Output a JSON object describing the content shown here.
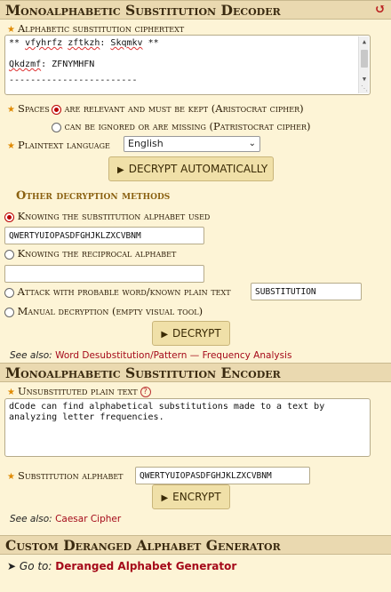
{
  "decoder": {
    "title": "Monoalphabetic Substitution Decoder",
    "ciphertext_label": "Alphabetic substitution ciphertext",
    "ciphertext_lines": [
      [
        "** ",
        "vfyhrfz",
        " ",
        "zftkzh",
        ": ",
        "Skqmkv",
        " **"
      ],
      [
        "",
        "",
        "",
        "",
        "",
        "",
        ""
      ],
      [
        "",
        "Qkdzmf",
        ": ZFNYMHFN",
        "",
        "",
        "",
        ""
      ],
      [
        "",
        "",
        "------------------------",
        "",
        "",
        "",
        ""
      ]
    ],
    "spaces_label": "Spaces",
    "spaces_opt1": "are relevant and must be kept (Aristocrat cipher)",
    "spaces_opt2": "can be ignored or are missing (Patristocrat cipher)",
    "plaintext_lang_label": "Plaintext language",
    "plaintext_lang_value": "English",
    "decrypt_auto_label": "DECRYPT AUTOMATICALLY",
    "other_methods_title": "Other decryption methods",
    "method1_label": "Knowing the substitution alphabet used",
    "method1_value": "QWERTYUIOPASDFGHJKLZXCVBNM",
    "method2_label": "Knowing the reciprocal alphabet",
    "method2_value": "",
    "method3_label": "Attack with probable word/known plain text",
    "method3_value": "SUBSTITUTION",
    "method4_label": "Manual decryption (empty visual tool)",
    "decrypt_label": "DECRYPT",
    "see_also_prefix": "See also:",
    "see_also_links": "Word Desubstitution/Pattern — Frequency Analysis"
  },
  "encoder": {
    "title": "Monoalphabetic Substitution Encoder",
    "plaintext_label": "Unsubstituted plain text",
    "plaintext_value": "dCode can find alphabetical substitutions made to a text by analyzing letter frequencies.",
    "alphabet_label": "Substitution alphabet",
    "alphabet_value": "QWERTYUIOPASDFGHJKLZXCVBNM",
    "encrypt_label": "ENCRYPT",
    "see_also_prefix": "See also:",
    "see_also_link": "Caesar Cipher"
  },
  "generator": {
    "title": "Custom Deranged Alphabet Generator",
    "goto_prefix": "Go to:",
    "goto_link": "Deranged Alphabet Generator"
  },
  "icons": {
    "refresh": "refresh-icon",
    "required": "star-icon",
    "play": "play-icon",
    "help": "question-icon",
    "arrow": "arrow-icon"
  },
  "colors": {
    "header_bg": "#ead9b0",
    "panel_bg": "#fdf4d6",
    "link": "#a50a1a",
    "accent": "#e08a00",
    "button_bg": "#f0e0a8"
  }
}
